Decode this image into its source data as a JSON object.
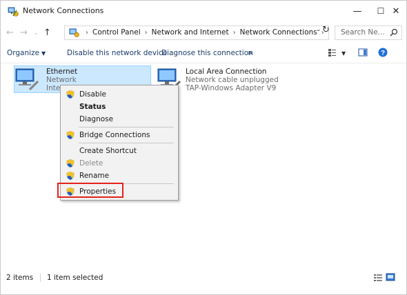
{
  "window": {
    "title": "Network Connections",
    "controls": {
      "minimize": "—",
      "maximize": "☐",
      "close": "✕"
    }
  },
  "address": {
    "crumbs": [
      "Control Panel",
      "Network and Internet",
      "Network Connections"
    ],
    "search_placeholder": "Search Ne..."
  },
  "commands": {
    "organize": "Organize",
    "disable": "Disable this network device",
    "diagnose": "Diagnose this connection",
    "more": "»"
  },
  "connections": [
    {
      "name": "Ethernet",
      "status": "Network",
      "device": "Intel",
      "selected": true
    },
    {
      "name": "Local Area Connection",
      "status": "Network cable unplugged",
      "device": "TAP-Windows Adapter V9",
      "selected": false
    }
  ],
  "context_menu": {
    "items": [
      {
        "label": "Disable",
        "icon": "shield-icon"
      },
      {
        "label": "Status",
        "default": true
      },
      {
        "label": "Diagnose"
      },
      {
        "label": "Bridge Connections",
        "icon": "shield-icon"
      },
      {
        "label": "Create Shortcut"
      },
      {
        "label": "Delete",
        "icon": "shield-icon",
        "disabled": true
      },
      {
        "label": "Rename",
        "icon": "shield-icon"
      },
      {
        "label": "Properties",
        "icon": "shield-icon",
        "highlighted": true
      }
    ]
  },
  "status": {
    "items_count": "2 items",
    "selected_count": "1 item selected"
  },
  "colors": {
    "selection_bg": "#cce8ff",
    "highlight_border": "#e2231a",
    "command_text": "#1a3b6b"
  }
}
